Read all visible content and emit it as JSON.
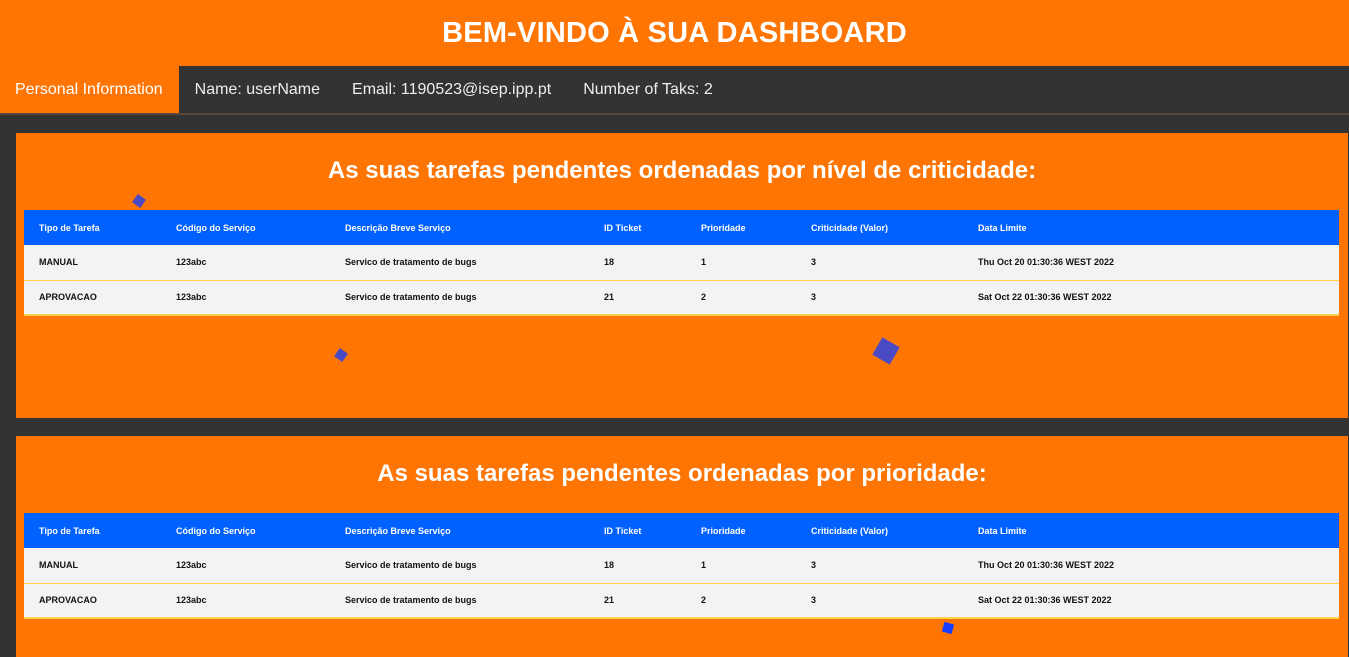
{
  "header": {
    "title": "BEM-VINDO À SUA DASHBOARD"
  },
  "nav": {
    "items": [
      {
        "label": "Personal Information"
      },
      {
        "label": "Name: userName"
      },
      {
        "label": "Email: 1190523@isep.ipp.pt"
      },
      {
        "label": "Number of Taks: 2"
      }
    ]
  },
  "panels": [
    {
      "title": "As suas tarefas pendentes ordenadas por nível de criticidade:",
      "columns": [
        "Tipo de Tarefa",
        "Código do Serviço",
        "Descrição Breve Serviço",
        "ID Ticket",
        "Prioridade",
        "Criticidade (Valor)",
        "Data Limite"
      ],
      "rows": [
        [
          "MANUAL",
          "123abc",
          "Servico de tratamento de bugs",
          "18",
          "1",
          "3",
          "Thu Oct 20 01:30:36 WEST 2022"
        ],
        [
          "APROVACAO",
          "123abc",
          "Servico de tratamento de bugs",
          "21",
          "2",
          "3",
          "Sat Oct 22 01:30:36 WEST 2022"
        ]
      ]
    },
    {
      "title": "As suas tarefas pendentes ordenadas por prioridade:",
      "columns": [
        "Tipo de Tarefa",
        "Código do Serviço",
        "Descrição Breve Serviço",
        "ID Ticket",
        "Prioridade",
        "Criticidade (Valor)",
        "Data Limite"
      ],
      "rows": [
        [
          "MANUAL",
          "123abc",
          "Servico de tratamento de bugs",
          "18",
          "1",
          "3",
          "Thu Oct 20 01:30:36 WEST 2022"
        ],
        [
          "APROVACAO",
          "123abc",
          "Servico de tratamento de bugs",
          "21",
          "2",
          "3",
          "Sat Oct 22 01:30:36 WEST 2022"
        ]
      ]
    }
  ],
  "colors": {
    "accent": "#ff7504",
    "table_header": "#0061ff",
    "background": "#333333",
    "confetti": "#4a4ac4"
  }
}
